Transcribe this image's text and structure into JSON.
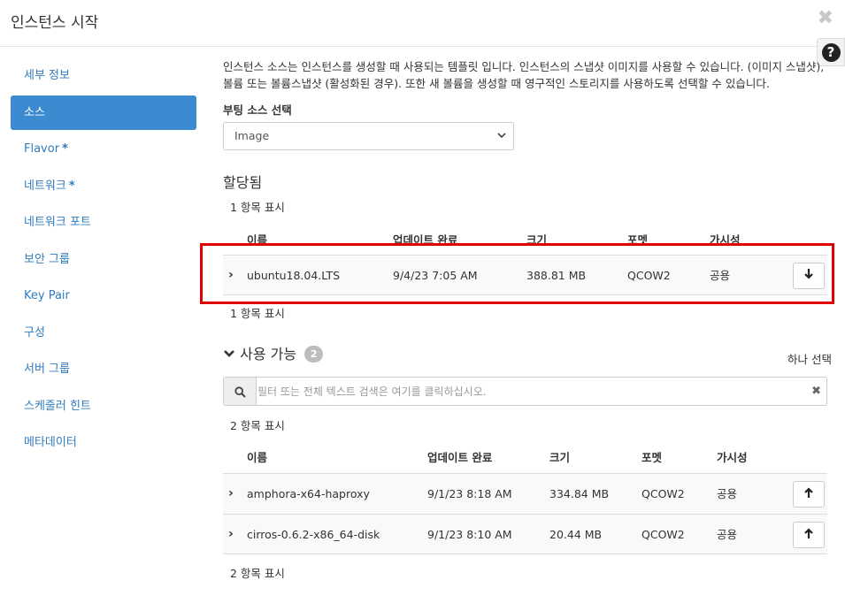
{
  "modal": {
    "title": "인스턴스 시작",
    "close_glyph": "✖",
    "help_glyph": "?"
  },
  "sidebar": {
    "items": [
      {
        "label": "세부 정보",
        "required": false,
        "active": false
      },
      {
        "label": "소스",
        "required": false,
        "active": true
      },
      {
        "label": "Flavor",
        "required": true,
        "active": false
      },
      {
        "label": "네트워크",
        "required": true,
        "active": false
      },
      {
        "label": "네트워크 포트",
        "required": false,
        "active": false
      },
      {
        "label": "보안 그룹",
        "required": false,
        "active": false
      },
      {
        "label": "Key Pair",
        "required": false,
        "active": false
      },
      {
        "label": "구성",
        "required": false,
        "active": false
      },
      {
        "label": "서버 그룹",
        "required": false,
        "active": false
      },
      {
        "label": "스케줄러 힌트",
        "required": false,
        "active": false
      },
      {
        "label": "메타데이터",
        "required": false,
        "active": false
      }
    ],
    "required_marker": "*"
  },
  "main": {
    "description": "인스턴스 소스는 인스턴스를 생성할 때 사용되는 템플릿 입니다. 인스턴스의 스냅샷 이미지를 사용할 수 있습니다. (이미지 스냅샷), 볼륨 또는 볼륨스냅샷 (활성화된 경우). 또한 새 볼륨을 생성할 때 영구적인 스토리지를 사용하도록 선택할 수 있습니다.",
    "boot_source_label": "부팅 소스 선택",
    "boot_source_value": "Image",
    "allocated": {
      "title": "할당됨",
      "count_top": "1 항목 표시",
      "count_bottom": "1 항목 표시",
      "columns": [
        "이름",
        "업데이트 완료",
        "크기",
        "포멧",
        "가시성"
      ],
      "rows": [
        {
          "name": "ubuntu18.04.LTS",
          "updated": "9/4/23 7:05 AM",
          "size": "388.81 MB",
          "format": "QCOW2",
          "visibility": "공용"
        }
      ]
    },
    "available": {
      "title": "사용 가능",
      "badge": "2",
      "select_one": "하나 선택",
      "search_placeholder": "필터 또는 전체 텍스트 검색은 여기를 클릭하십시오.",
      "count_top": "2 항목 표시",
      "count_bottom": "2 항목 표시",
      "columns": [
        "이름",
        "업데이트 완료",
        "크기",
        "포멧",
        "가시성"
      ],
      "rows": [
        {
          "name": "amphora-x64-haproxy",
          "updated": "9/1/23 8:18 AM",
          "size": "334.84 MB",
          "format": "QCOW2",
          "visibility": "공용"
        },
        {
          "name": "cirros-0.6.2-x86_64-disk",
          "updated": "9/1/23 8:10 AM",
          "size": "20.44 MB",
          "format": "QCOW2",
          "visibility": "공용"
        }
      ]
    }
  },
  "colors": {
    "accent": "#3c8ad0",
    "link": "#2f7bbf",
    "highlight": "#e00000"
  }
}
